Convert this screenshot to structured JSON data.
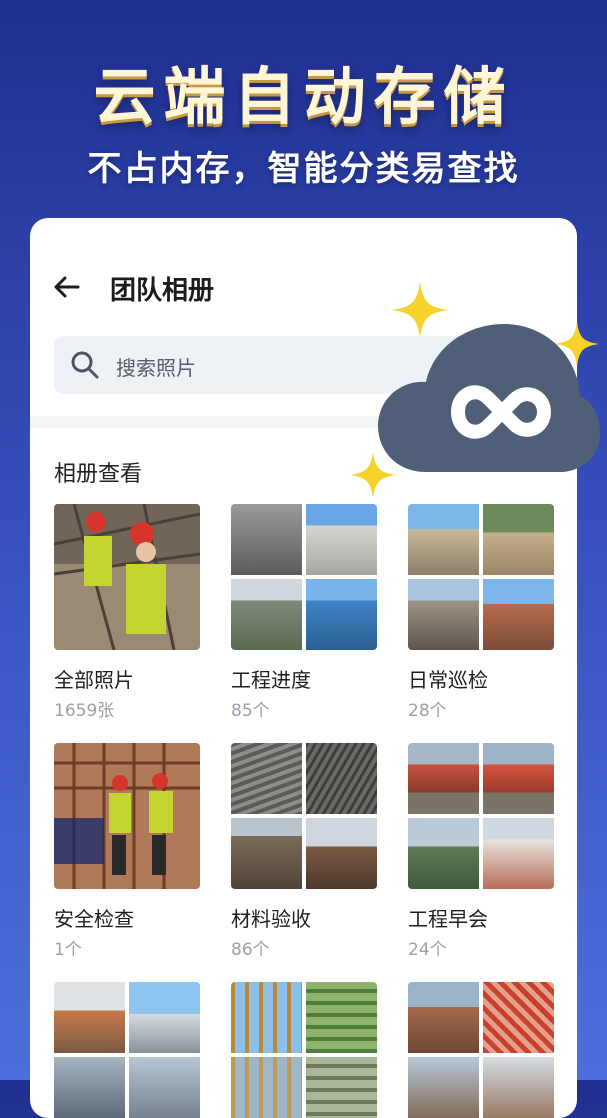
{
  "promo": {
    "headline": "云端自动存储",
    "subheadline": "不占内存，智能分类易查找"
  },
  "header": {
    "back_icon": "arrow-left-icon",
    "title": "团队相册"
  },
  "search": {
    "icon": "search-icon",
    "placeholder": "搜索照片"
  },
  "section": {
    "title": "相册查看"
  },
  "albums": [
    {
      "name": "全部照片",
      "count": "1659张"
    },
    {
      "name": "工程进度",
      "count": "85个"
    },
    {
      "name": "日常巡检",
      "count": "28个"
    },
    {
      "name": "安全检查",
      "count": "1个"
    },
    {
      "name": "材料验收",
      "count": "86个"
    },
    {
      "name": "工程早会",
      "count": "24个"
    },
    {
      "name": "",
      "count": ""
    },
    {
      "name": "",
      "count": ""
    },
    {
      "name": "",
      "count": ""
    }
  ],
  "colors": {
    "background_top": "#1e2f8f",
    "background_bottom": "#4d6fdc",
    "cloud": "#4f5f78",
    "sparkle": "#f6d22a",
    "headline": "#fff6d8"
  },
  "decorations": {
    "cloud_icon": "infinity-cloud-icon",
    "sparkle_icon": "four-point-star-icon"
  }
}
